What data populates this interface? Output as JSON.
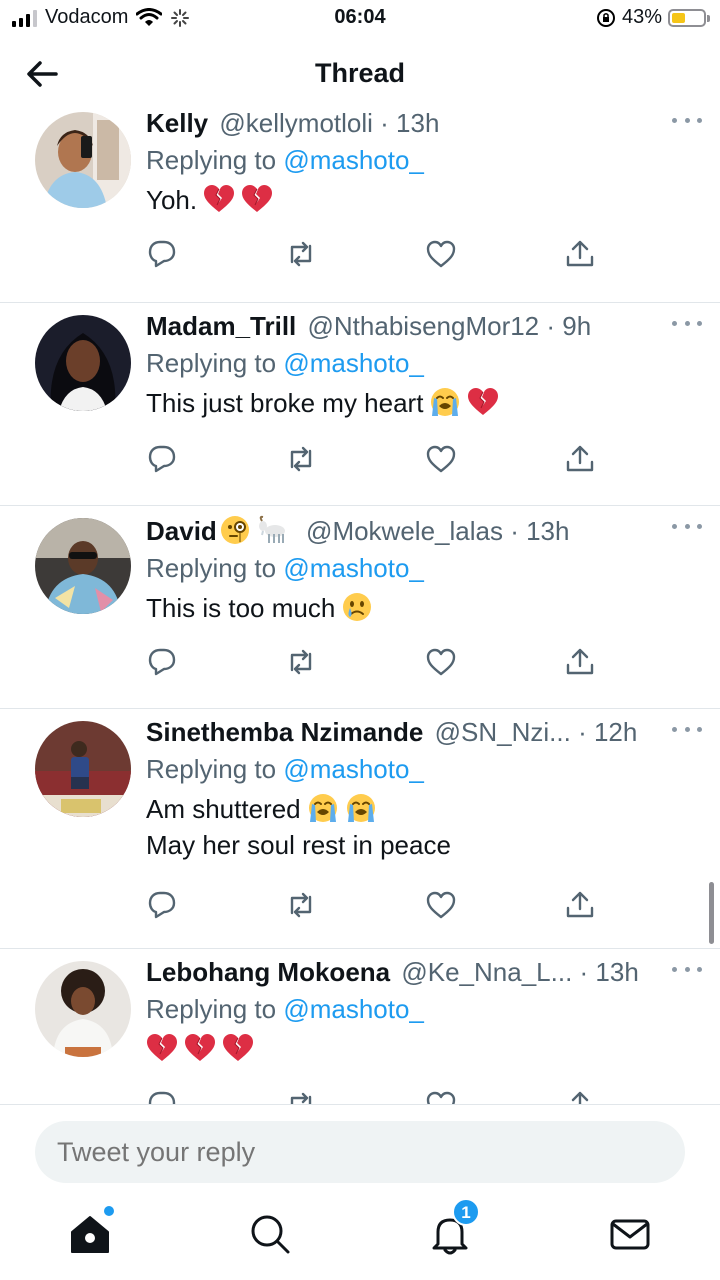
{
  "status_bar": {
    "carrier": "Vodacom",
    "time": "06:04",
    "battery_percent": "43%",
    "battery_level": 0.43
  },
  "header": {
    "title": "Thread"
  },
  "replying_prefix": "Replying to",
  "tweets": [
    {
      "name": "Kelly",
      "handle": "@kellymotloli",
      "time": "· 13h",
      "replying_to": "@mashoto_",
      "text": "Yoh.",
      "text2": "",
      "emojis": [
        "broken-heart",
        "broken-heart"
      ]
    },
    {
      "name": "Madam_Trill",
      "handle": "@NthabisengMor12",
      "time": "· 9h",
      "replying_to": "@mashoto_",
      "text": "This just broke my heart",
      "text2": "",
      "emojis": [
        "loudly-crying-face",
        "broken-heart"
      ]
    },
    {
      "name": "David",
      "handle": "@Mokwele_lalas",
      "time": "· 13h",
      "replying_to": "@mashoto_",
      "text": "This is too much",
      "text2": "",
      "name_emojis": [
        "face-with-monocle",
        "goat"
      ],
      "emojis": [
        "crying-face"
      ]
    },
    {
      "name": "Sinethemba Nzimande",
      "handle": "@SN_Nzi...",
      "time": "· 12h",
      "replying_to": "@mashoto_",
      "text": "Am shuttered",
      "text2": "May her soul rest in peace",
      "emojis": [
        "loudly-crying-face",
        "loudly-crying-face"
      ]
    },
    {
      "name": "Lebohang Mokoena",
      "handle": "@Ke_Nna_L...",
      "time": "· 13h",
      "replying_to": "@mashoto_",
      "text": "",
      "text2": "",
      "emojis": [
        "broken-heart",
        "broken-heart",
        "broken-heart"
      ]
    }
  ],
  "reply": {
    "placeholder": "Tweet your reply"
  },
  "tabbar": {
    "notifications_count": "1"
  },
  "colors": {
    "accent": "#1d9bf0",
    "muted": "#536471",
    "divider": "#e1e6ea"
  }
}
